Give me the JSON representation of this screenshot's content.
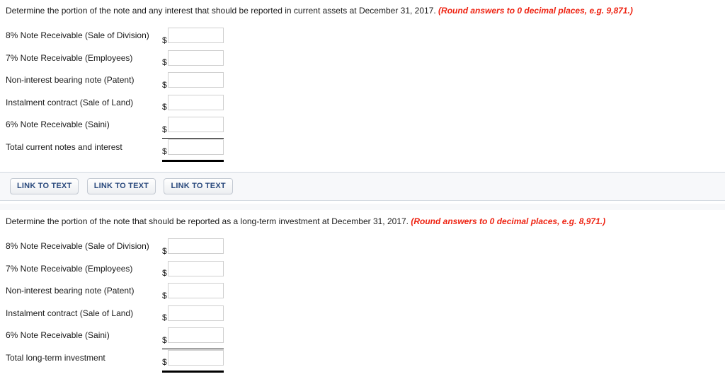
{
  "sections": [
    {
      "prompt_text": "Determine the portion of the note and any interest that should be reported in current assets at December 31, 2017.",
      "round_note": "(Round answers to 0 decimal places, e.g. 9,871.)",
      "currency_symbol": "$",
      "input_placeholder": "",
      "rows": [
        {
          "label": "8% Note Receivable (Sale of Division)",
          "value": ""
        },
        {
          "label": "7% Note Receivable (Employees)",
          "value": ""
        },
        {
          "label": "Non-interest bearing note (Patent)",
          "value": ""
        },
        {
          "label": "Instalment contract (Sale of Land)",
          "value": ""
        },
        {
          "label": "6% Note Receivable (Saini)",
          "value": ""
        }
      ],
      "total_row": {
        "label": "Total current notes and interest",
        "value": ""
      }
    },
    {
      "prompt_text": "Determine the portion of the note that should be reported as a long-term investment at December 31, 2017.",
      "round_note": "(Round answers to 0 decimal places, e.g. 8,971.)",
      "currency_symbol": "$",
      "input_placeholder": "",
      "rows": [
        {
          "label": "8% Note Receivable (Sale of Division)",
          "value": ""
        },
        {
          "label": "7% Note Receivable (Employees)",
          "value": ""
        },
        {
          "label": "Non-interest bearing note (Patent)",
          "value": ""
        },
        {
          "label": "Instalment contract (Sale of Land)",
          "value": ""
        },
        {
          "label": "6% Note Receivable (Saini)",
          "value": ""
        }
      ],
      "total_row": {
        "label": "Total long-term investment",
        "value": ""
      }
    }
  ],
  "link_bar": {
    "buttons": [
      {
        "label": "LINK TO TEXT"
      },
      {
        "label": "LINK TO TEXT"
      },
      {
        "label": "LINK TO TEXT"
      }
    ]
  },
  "colors": {
    "round_note_red": "#ee2211",
    "button_text_navy": "#2b4a7d",
    "band_background": "#f7f8fa",
    "band_border": "#d3d9e0",
    "field_border": "#cfcfcf",
    "rule_black": "#000000"
  }
}
